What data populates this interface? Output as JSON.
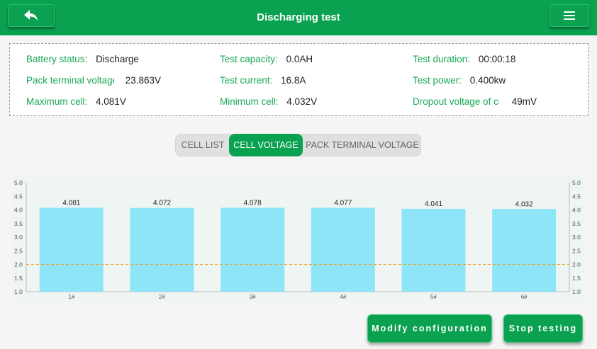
{
  "header": {
    "title": "Discharging test",
    "back_icon": "back-arrow-icon",
    "menu_icon": "hamburger-menu-icon",
    "accent": "#0aa150"
  },
  "info": {
    "battery_status": {
      "label": "Battery status:",
      "value": "Discharge"
    },
    "test_capacity": {
      "label": "Test capacity:",
      "value": "0.0AH"
    },
    "test_duration": {
      "label": "Test duration:",
      "value": "00:00:18"
    },
    "pack_terminal_voltage": {
      "label": "Pack terminal voltage",
      "value": "23.863V"
    },
    "test_current": {
      "label": "Test current:",
      "value": "16.8A"
    },
    "test_power": {
      "label": "Test power:",
      "value": "0.400kw"
    },
    "maximum_cell": {
      "label": "Maximum cell:",
      "value": "4.081V"
    },
    "minimum_cell": {
      "label": "Minimum cell:",
      "value": "4.032V"
    },
    "dropout_voltage": {
      "label": "Dropout voltage of cell:",
      "value": "49mV"
    }
  },
  "tabs": [
    {
      "label": "CELL LIST",
      "active": false
    },
    {
      "label": "CELL VOLTAGE",
      "active": true
    },
    {
      "label": "PACK TERMINAL VOLTAGE",
      "active": false
    }
  ],
  "chart_data": {
    "type": "bar",
    "categories": [
      "1#",
      "2#",
      "3#",
      "4#",
      "5#",
      "6#"
    ],
    "values": [
      4.081,
      4.072,
      4.078,
      4.077,
      4.041,
      4.032
    ],
    "data_labels": [
      "4.081",
      "4.072",
      "4.078",
      "4.077",
      "4.041",
      "4.032"
    ],
    "ylim": [
      1.0,
      5.0
    ],
    "yticks": [
      "1.0",
      "1.5",
      "2.0",
      "2.5",
      "3.0",
      "3.5",
      "4.0",
      "4.5",
      "5.0"
    ],
    "threshold": 2.0,
    "bar_color": "#8fe5f8",
    "threshold_color": "#f0a020",
    "secondary_axis": true
  },
  "actions": {
    "modify": "Modify configuration",
    "stop": "Stop testing"
  }
}
